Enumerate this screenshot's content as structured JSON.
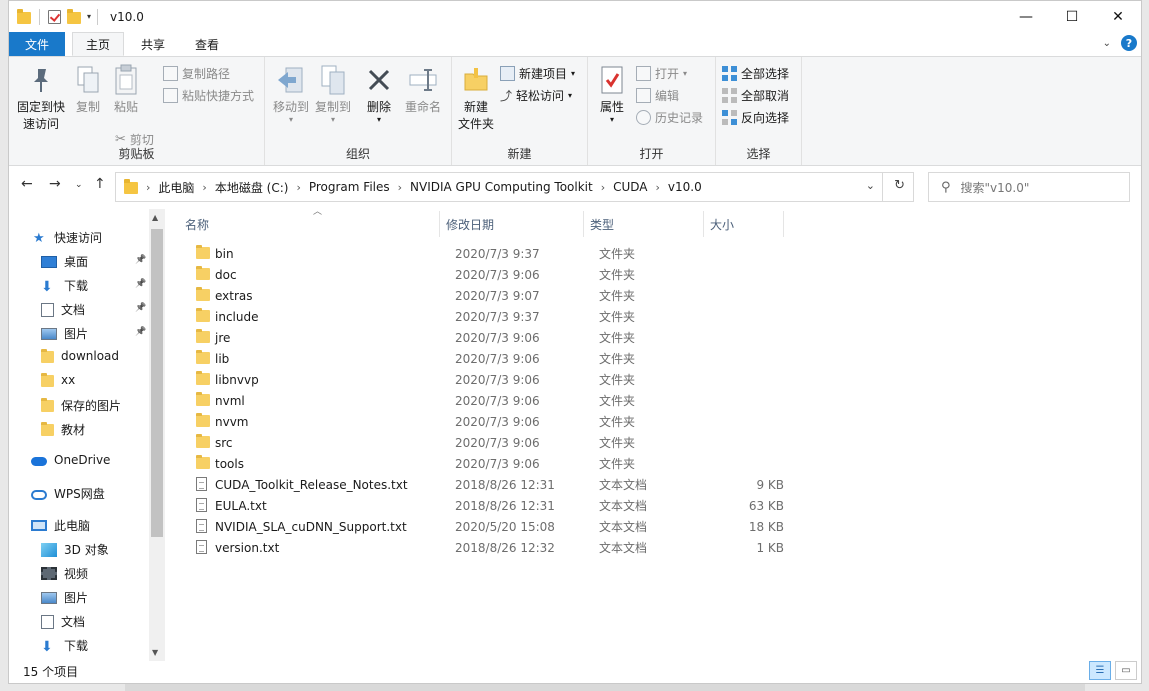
{
  "window": {
    "title": "v10.0"
  },
  "window_controls": {
    "minimize": "—",
    "maximize": "☐",
    "close": "✕"
  },
  "tabs": [
    {
      "label": "文件"
    },
    {
      "label": "主页"
    },
    {
      "label": "共享"
    },
    {
      "label": "查看"
    }
  ],
  "ribbon": {
    "clipboard": {
      "label": "剪贴板",
      "pin": "固定到快\n速访问",
      "pin_l1": "固定到快",
      "pin_l2": "速访问",
      "copy": "复制",
      "paste": "粘贴",
      "copy_path": "复制路径",
      "paste_shortcut": "粘贴快捷方式",
      "cut": "剪切"
    },
    "organize": {
      "label": "组织",
      "move_to": "移动到",
      "copy_to": "复制到",
      "delete": "删除",
      "rename": "重命名"
    },
    "new": {
      "label": "新建",
      "new_folder_l1": "新建",
      "new_folder_l2": "文件夹",
      "new_item": "新建项目",
      "easy_access": "轻松访问"
    },
    "open": {
      "label": "打开",
      "properties": "属性",
      "open": "打开",
      "edit": "编辑",
      "history": "历史记录"
    },
    "select": {
      "label": "选择",
      "select_all": "全部选择",
      "select_none": "全部取消",
      "invert": "反向选择"
    }
  },
  "breadcrumb": [
    "此电脑",
    "本地磁盘 (C:)",
    "Program Files",
    "NVIDIA GPU Computing Toolkit",
    "CUDA",
    "v10.0"
  ],
  "search": {
    "placeholder": "搜索\"v10.0\""
  },
  "nav_pane": [
    {
      "label": "快速访问",
      "icon": "star-icon",
      "pinned": false
    },
    {
      "label": "桌面",
      "icon": "desktop-icon",
      "pinned": true
    },
    {
      "label": "下载",
      "icon": "download-arrow-icon",
      "pinned": true
    },
    {
      "label": "文档",
      "icon": "document-icon",
      "pinned": true
    },
    {
      "label": "图片",
      "icon": "picture-icon",
      "pinned": true
    },
    {
      "label": "download",
      "icon": "folder-icon",
      "pinned": false
    },
    {
      "label": "xx",
      "icon": "folder-icon",
      "pinned": false
    },
    {
      "label": "保存的图片",
      "icon": "folder-icon",
      "pinned": false
    },
    {
      "label": "教材",
      "icon": "folder-icon",
      "pinned": false
    },
    {
      "label": "OneDrive",
      "icon": "cloud-icon",
      "pinned": false
    },
    {
      "label": "WPS网盘",
      "icon": "cloud-outline-icon",
      "pinned": false
    },
    {
      "label": "此电脑",
      "icon": "computer-icon",
      "pinned": false
    },
    {
      "label": "3D 对象",
      "icon": "cube-icon",
      "pinned": false
    },
    {
      "label": "视频",
      "icon": "video-icon",
      "pinned": false
    },
    {
      "label": "图片",
      "icon": "picture-icon",
      "pinned": false
    },
    {
      "label": "文档",
      "icon": "document-icon",
      "pinned": false
    },
    {
      "label": "下载",
      "icon": "download-arrow-icon",
      "pinned": false
    }
  ],
  "columns": {
    "name": "名称",
    "date": "修改日期",
    "type": "类型",
    "size": "大小"
  },
  "files": [
    {
      "name": "bin",
      "date": "2020/7/3 9:37",
      "type": "文件夹",
      "size": "",
      "kind": "folder"
    },
    {
      "name": "doc",
      "date": "2020/7/3 9:06",
      "type": "文件夹",
      "size": "",
      "kind": "folder"
    },
    {
      "name": "extras",
      "date": "2020/7/3 9:07",
      "type": "文件夹",
      "size": "",
      "kind": "folder"
    },
    {
      "name": "include",
      "date": "2020/7/3 9:37",
      "type": "文件夹",
      "size": "",
      "kind": "folder"
    },
    {
      "name": "jre",
      "date": "2020/7/3 9:06",
      "type": "文件夹",
      "size": "",
      "kind": "folder"
    },
    {
      "name": "lib",
      "date": "2020/7/3 9:06",
      "type": "文件夹",
      "size": "",
      "kind": "folder"
    },
    {
      "name": "libnvvp",
      "date": "2020/7/3 9:06",
      "type": "文件夹",
      "size": "",
      "kind": "folder"
    },
    {
      "name": "nvml",
      "date": "2020/7/3 9:06",
      "type": "文件夹",
      "size": "",
      "kind": "folder"
    },
    {
      "name": "nvvm",
      "date": "2020/7/3 9:06",
      "type": "文件夹",
      "size": "",
      "kind": "folder"
    },
    {
      "name": "src",
      "date": "2020/7/3 9:06",
      "type": "文件夹",
      "size": "",
      "kind": "folder"
    },
    {
      "name": "tools",
      "date": "2020/7/3 9:06",
      "type": "文件夹",
      "size": "",
      "kind": "folder"
    },
    {
      "name": "CUDA_Toolkit_Release_Notes.txt",
      "date": "2018/8/26 12:31",
      "type": "文本文档",
      "size": "9 KB",
      "kind": "text"
    },
    {
      "name": "EULA.txt",
      "date": "2018/8/26 12:31",
      "type": "文本文档",
      "size": "63 KB",
      "kind": "text"
    },
    {
      "name": "NVIDIA_SLA_cuDNN_Support.txt",
      "date": "2020/5/20 15:08",
      "type": "文本文档",
      "size": "18 KB",
      "kind": "text"
    },
    {
      "name": "version.txt",
      "date": "2018/8/26 12:32",
      "type": "文本文档",
      "size": "1 KB",
      "kind": "text"
    }
  ],
  "status": {
    "item_count": "15 个项目"
  },
  "colors": {
    "accent": "#1979ca",
    "folder": "#f7d064",
    "header_text": "#4c607a"
  }
}
